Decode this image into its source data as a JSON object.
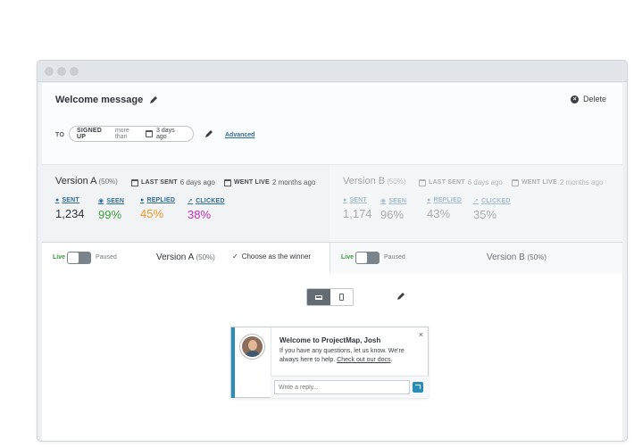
{
  "header": {
    "title": "Welcome message",
    "delete_label": "Delete",
    "to_label": "TO",
    "filter": {
      "attribute": "SIGNED UP",
      "operator": "more than",
      "value": "3 days ago"
    },
    "advanced_label": "Advanced"
  },
  "versions": [
    {
      "name": "Version A",
      "split": "(50%)",
      "last_sent_label": "LAST SENT",
      "last_sent": "6 days ago",
      "went_live_label": "WENT LIVE",
      "went_live": "2 months ago",
      "stats": [
        {
          "label": "SENT",
          "value": "1,234",
          "color": "#2f343a"
        },
        {
          "label": "SEEN",
          "value": "99%",
          "color": "#3aa03d"
        },
        {
          "label": "REPLIED",
          "value": "45%",
          "color": "#f0951f"
        },
        {
          "label": "CLICKED",
          "value": "38%",
          "color": "#c62fb7"
        }
      ]
    },
    {
      "name": "Version B",
      "split": "(50%)",
      "last_sent_label": "LAST SENT",
      "last_sent": "6 days ago",
      "went_live_label": "WENT LIVE",
      "went_live": "2 months ago",
      "stats": [
        {
          "label": "SENT",
          "value": "1,174"
        },
        {
          "label": "SEEN",
          "value": "96%"
        },
        {
          "label": "REPLIED",
          "value": "43%"
        },
        {
          "label": "CLICKED",
          "value": "35%"
        }
      ]
    }
  ],
  "toggle_row": {
    "live_label": "Live",
    "paused_label": "Paused",
    "version_a": "Version A",
    "version_a_split": "(50%)",
    "winner_label": "Choose as the winner",
    "version_b": "Version B",
    "version_b_split": "(50%)"
  },
  "preview": {
    "message_title": "Welcome to ProjectMap, Josh",
    "message_body": "If you have any questions, let us know. We're always here to help.",
    "message_link": "Check out our docs",
    "message_link_suffix": ".",
    "reply_placeholder": "Write a reply...",
    "close_glyph": "×"
  },
  "colors": {
    "accent": "#2a8db5",
    "link": "#2d6d99",
    "live": "#3a9a3c"
  }
}
